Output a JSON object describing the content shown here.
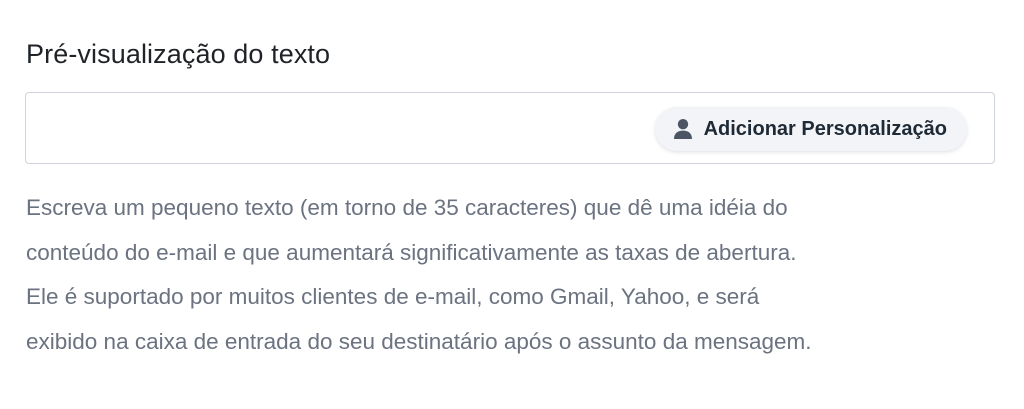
{
  "field": {
    "label": "Pré-visualização do texto",
    "value": "",
    "placeholder": ""
  },
  "personalize_button": {
    "label": "Adicionar Personalização",
    "icon": "user-icon"
  },
  "help_text": {
    "lines": [
      "Escreva um pequeno texto (em torno de 35 caracteres) que dê uma idéia do",
      "conteúdo do e-mail e que aumentará significativamente as taxas de abertura.",
      "Ele é suportado por muitos clientes de e-mail, como Gmail, Yahoo, e será",
      "exibido na caixa de entrada do seu destinatário após o assunto da mensagem."
    ]
  },
  "colors": {
    "label_text": "#1f2328",
    "help_text": "#6b7280",
    "input_border": "#cfd4da",
    "button_background": "#f2f4f7",
    "button_text": "#1f2a37",
    "icon": "#4b5563"
  }
}
